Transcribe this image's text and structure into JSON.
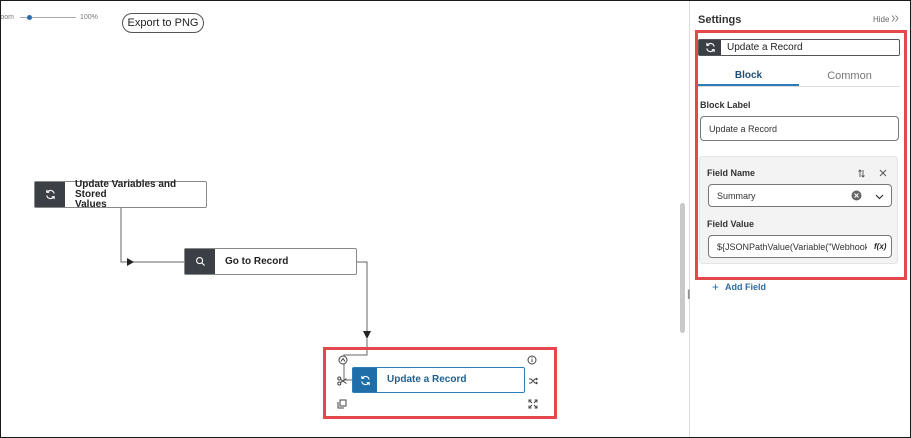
{
  "toolbar": {
    "zoom_label": "Zoom:",
    "zoom_value": "100%",
    "zoom_level_percent": 10,
    "export_label": "Export to PNG"
  },
  "flow": {
    "nodes": [
      {
        "label_line1": "Update Variables and Stored",
        "label_line2": "Values",
        "icon": "refresh-icon"
      },
      {
        "label": "Go to Record",
        "icon": "search-icon"
      },
      {
        "label": "Update a Record",
        "icon": "refresh-icon"
      }
    ]
  },
  "settings": {
    "title": "Settings",
    "hide_label": "Hide",
    "block_title": "Update a Record",
    "tabs": [
      {
        "label": "Block",
        "active": true
      },
      {
        "label": "Common",
        "active": false
      }
    ],
    "block_label_caption": "Block Label",
    "block_label_value": "Update a Record",
    "field_name_caption": "Field Name",
    "field_name_value": "Summary",
    "field_value_caption": "Field Value",
    "field_value_value": "${JSONPathValue(Variable(\"Webhook",
    "function_button": "f(x)",
    "add_field_label": "Add Field"
  },
  "colors": {
    "accent": "#2a7db8",
    "highlight": "#e4474c",
    "node_icon_bg": "#3b3f46"
  }
}
